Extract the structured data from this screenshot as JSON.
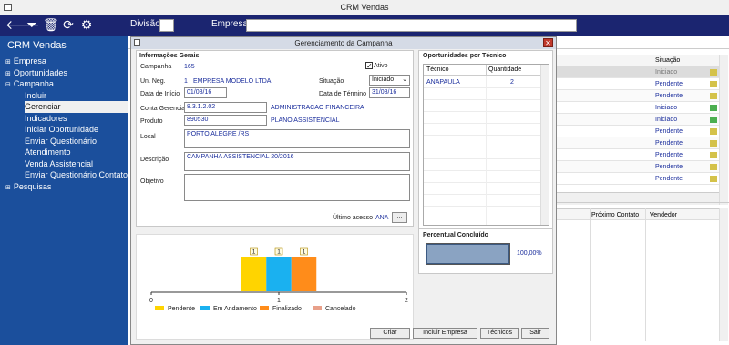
{
  "window": {
    "title": "CRM Vendas"
  },
  "toolbar": {
    "icons": [
      "back-arrow-icon",
      "filter-icon",
      "trash-icon",
      "refresh-icon",
      "gear-icon"
    ],
    "divisao_label": "Divisão",
    "empresa_label": "Empresa",
    "divisao_value": "",
    "empresa_value": ""
  },
  "sidebar": {
    "title": "CRM Vendas",
    "items": [
      {
        "label": "Empresa",
        "type": "top"
      },
      {
        "label": "Oportunidades",
        "type": "top"
      },
      {
        "label": "Campanha",
        "type": "open"
      },
      {
        "label": "Incluir",
        "type": "sub"
      },
      {
        "label": "Gerenciar",
        "type": "sub",
        "selected": true
      },
      {
        "label": "Indicadores",
        "type": "sub"
      },
      {
        "label": "Iniciar Oportunidade",
        "type": "sub"
      },
      {
        "label": "Enviar Questionário",
        "type": "sub"
      },
      {
        "label": "Atendimento",
        "type": "sub"
      },
      {
        "label": "Venda Assistencial",
        "type": "sub"
      },
      {
        "label": "Enviar Questionário Contato",
        "type": "sub"
      },
      {
        "label": "Pesquisas",
        "type": "top"
      }
    ]
  },
  "background_grid": {
    "header_situacao": "Situação",
    "rows": [
      "Iniciado",
      "Pendente",
      "Pendente",
      "Iniciado",
      "Iniciado",
      "Pendente",
      "Pendente",
      "Pendente",
      "Pendente",
      "Pendente"
    ],
    "lower_headers": [
      "Próximo Contato",
      "Vendedor"
    ]
  },
  "dialog": {
    "title": "Gerenciamento da Campanha",
    "close_label": "✕",
    "info": {
      "section_title": "Informações Gerais",
      "campanha_label": "Campanha",
      "campanha_value": "165",
      "ativo_label": "Ativo",
      "un_neg_label": "Un. Neg.",
      "un_neg_code": "1",
      "un_neg_name": "EMPRESA MODELO LTDA",
      "situacao_label": "Situação",
      "situacao_value": "Iniciado",
      "data_inicio_label": "Data de Início",
      "data_inicio_value": "01/08/16",
      "data_termino_label": "Data de Término",
      "data_termino_value": "31/08/16",
      "conta_label": "Conta Gerencial",
      "conta_code": "8.3.1.2.02",
      "conta_name": "ADMINISTRACAO  FINANCEIRA",
      "produto_label": "Produto",
      "produto_code": "890530",
      "produto_name": "PLANO ASSISTENCIAL",
      "local_label": "Local",
      "local_value": "PORTO ALEGRE /RS",
      "descricao_label": "Descrição",
      "descricao_value": "CAMPANHA ASSISTENCIAL 20/2016",
      "objetivo_label": "Objetivo",
      "objetivo_value": "",
      "ultimo_acesso_label": "Último acesso",
      "ultimo_acesso_value": "ANA",
      "ellipsis_label": "..."
    },
    "oportunidades": {
      "section_title": "Oportunidades por Técnico",
      "col_tecnico": "Técnico",
      "col_quantidade": "Quantidade",
      "rows": [
        {
          "tecnico": "ANAPAULA",
          "quantidade": "2"
        }
      ]
    },
    "percentual": {
      "section_title": "Percentual Concluído",
      "value_text": "100,00%",
      "value": 100
    },
    "buttons": {
      "criar": "Criar",
      "incluir_empresa": "Incluir Empresa",
      "tecnicos": "Técnicos",
      "sair": "Sair"
    }
  },
  "chart_data": {
    "type": "bar",
    "orientation": "horizontal",
    "stacked": true,
    "xlim": [
      0,
      2
    ],
    "x_ticks": [
      "0",
      "1",
      "2"
    ],
    "series": [
      {
        "name": "Pendente",
        "values": [
          1
        ],
        "color": "#ffd400"
      },
      {
        "name": "Em Andamento",
        "values": [
          1
        ],
        "color": "#1ab1f0"
      },
      {
        "name": "Finalizado",
        "values": [
          1
        ],
        "color": "#ff8c1a"
      },
      {
        "name": "Cancelado",
        "values": [
          0
        ],
        "color": "#e8a08a"
      }
    ],
    "data_labels": [
      "1",
      "1",
      "1"
    ],
    "grid": false,
    "legend_position": "bottom"
  }
}
